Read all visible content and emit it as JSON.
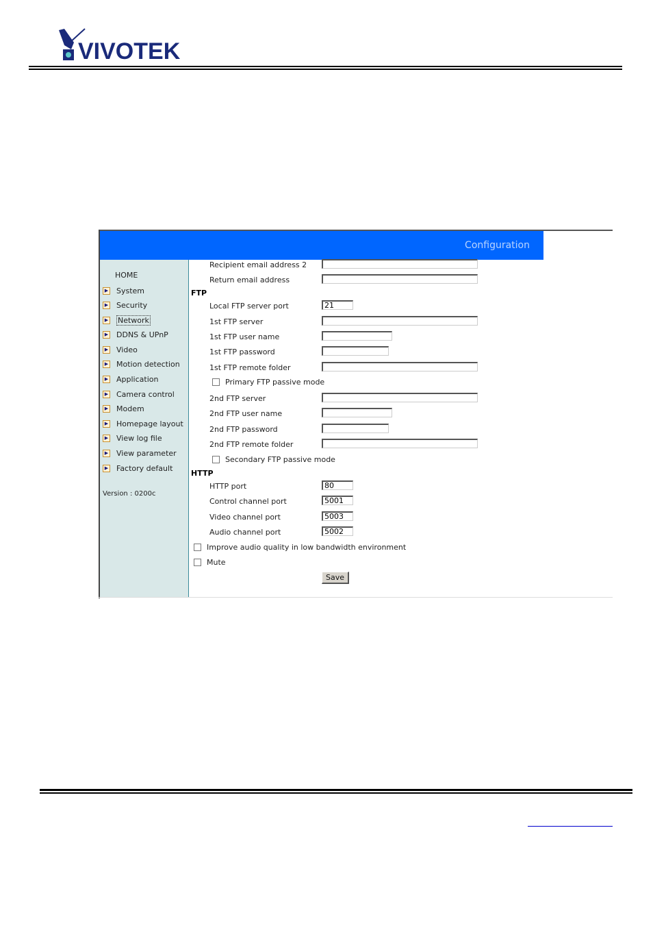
{
  "header": {
    "logo_text": "VIVOTEK"
  },
  "banner": {
    "title": "Configuration",
    "color": "#0066ff"
  },
  "sidebar": {
    "home_label": "HOME",
    "items": [
      {
        "label": "System",
        "icon": "arrow-right-icon"
      },
      {
        "label": "Security",
        "icon": "arrow-right-icon"
      },
      {
        "label": "Network",
        "icon": "arrow-right-icon",
        "active": true
      },
      {
        "label": "DDNS & UPnP",
        "icon": "arrow-right-icon"
      },
      {
        "label": "Video",
        "icon": "arrow-right-icon"
      },
      {
        "label": "Motion detection",
        "icon": "arrow-right-icon"
      },
      {
        "label": "Application",
        "icon": "arrow-right-icon"
      },
      {
        "label": "Camera control",
        "icon": "arrow-right-icon"
      },
      {
        "label": "Modem",
        "icon": "arrow-right-icon"
      },
      {
        "label": "Homepage layout",
        "icon": "arrow-right-icon"
      },
      {
        "label": "View log file",
        "icon": "arrow-right-icon"
      },
      {
        "label": "View parameter",
        "icon": "arrow-right-icon"
      },
      {
        "label": "Factory default",
        "icon": "arrow-right-icon"
      }
    ],
    "version": "Version : 0200c"
  },
  "form": {
    "email": {
      "recipient2_label": "Recipient email address 2",
      "recipient2_value": "",
      "return_label": "Return email address",
      "return_value": ""
    },
    "ftp": {
      "section_label": "FTP",
      "local_port_label": "Local FTP server port",
      "local_port_value": "21",
      "server1_label": "1st FTP server",
      "server1_value": "",
      "user1_label": "1st FTP user name",
      "user1_value": "",
      "password1_label": "1st FTP password",
      "password1_value": "",
      "folder1_label": "1st FTP remote folder",
      "folder1_value": "",
      "passive1_label": "Primary FTP passive mode",
      "passive1_checked": false,
      "server2_label": "2nd FTP server",
      "server2_value": "",
      "user2_label": "2nd FTP user name",
      "user2_value": "",
      "password2_label": "2nd FTP password",
      "password2_value": "",
      "folder2_label": "2nd FTP remote folder",
      "folder2_value": "",
      "passive2_label": "Secondary FTP passive mode",
      "passive2_checked": false
    },
    "http": {
      "section_label": "HTTP",
      "http_port_label": "HTTP port",
      "http_port_value": "80",
      "control_port_label": "Control channel port",
      "control_port_value": "5001",
      "video_port_label": "Video channel port",
      "video_port_value": "5003",
      "audio_port_label": "Audio channel port",
      "audio_port_value": "5002"
    },
    "improve_audio_label": "Improve audio quality in low bandwidth environment",
    "improve_audio_checked": false,
    "mute_label": "Mute",
    "mute_checked": false,
    "save_label": "Save"
  }
}
